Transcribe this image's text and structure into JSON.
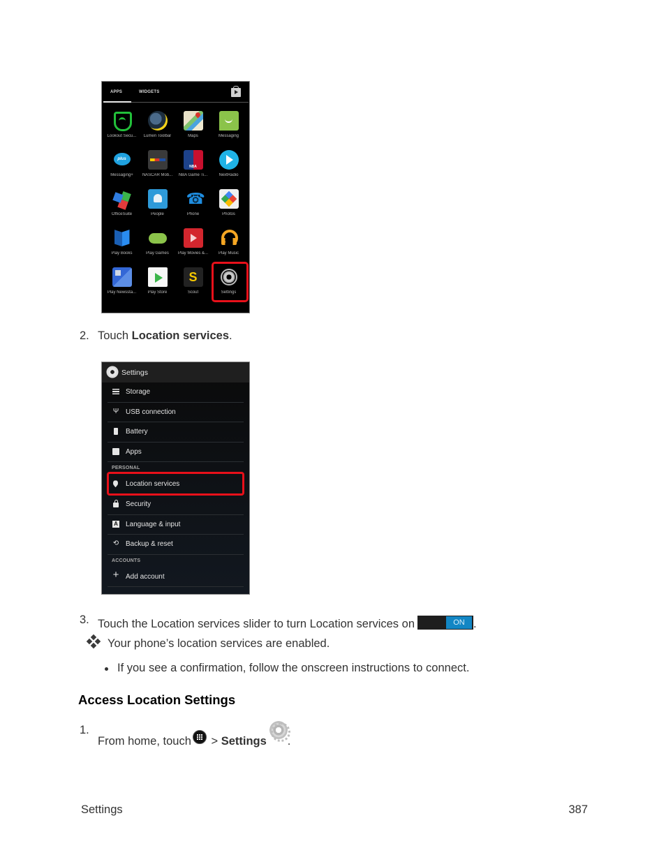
{
  "app_drawer": {
    "tabs": [
      "APPS",
      "WIDGETS"
    ],
    "store_icon": "play-store-bag-icon",
    "apps": [
      {
        "label": "Lookout Secu...",
        "icon": "lookout-icon"
      },
      {
        "label": "Lumen Toolbar",
        "icon": "lumen-icon"
      },
      {
        "label": "Maps",
        "icon": "maps-icon"
      },
      {
        "label": "Messaging",
        "icon": "messaging-icon"
      },
      {
        "label": "Messaging+",
        "icon": "messaging-plus-icon"
      },
      {
        "label": "NASCAR Mob...",
        "icon": "nascar-icon"
      },
      {
        "label": "NBA Game Ti...",
        "icon": "nba-icon"
      },
      {
        "label": "NextRadio",
        "icon": "nextradio-icon"
      },
      {
        "label": "OfficeSuite",
        "icon": "officesuite-icon"
      },
      {
        "label": "People",
        "icon": "people-icon"
      },
      {
        "label": "Phone",
        "icon": "phone-icon"
      },
      {
        "label": "Photos",
        "icon": "photos-icon"
      },
      {
        "label": "Play Books",
        "icon": "play-books-icon"
      },
      {
        "label": "Play Games",
        "icon": "play-games-icon"
      },
      {
        "label": "Play Movies &...",
        "icon": "play-movies-icon"
      },
      {
        "label": "Play Music",
        "icon": "play-music-icon"
      },
      {
        "label": "Play Newssta...",
        "icon": "play-newsstand-icon"
      },
      {
        "label": "Play Store",
        "icon": "play-store-icon"
      },
      {
        "label": "Scout",
        "icon": "scout-icon"
      },
      {
        "label": "Settings",
        "icon": "settings-gear-icon",
        "highlighted": true
      }
    ],
    "highlight_color": "#e8101a"
  },
  "step2": {
    "number": "2.",
    "prefix": "Touch ",
    "bold": "Location services",
    "suffix": "."
  },
  "settings_screen": {
    "title": "Settings",
    "rows": [
      {
        "type": "item",
        "label": "Storage",
        "icon": "storage-icon"
      },
      {
        "type": "item",
        "label": "USB connection",
        "icon": "usb-icon"
      },
      {
        "type": "item",
        "label": "Battery",
        "icon": "battery-icon"
      },
      {
        "type": "item",
        "label": "Apps",
        "icon": "apps-icon"
      },
      {
        "type": "section",
        "label": "PERSONAL"
      },
      {
        "type": "item",
        "label": "Location services",
        "icon": "location-pin-icon",
        "highlighted": true
      },
      {
        "type": "item",
        "label": "Security",
        "icon": "lock-icon"
      },
      {
        "type": "item",
        "label": "Language & input",
        "icon": "language-icon"
      },
      {
        "type": "item",
        "label": "Backup & reset",
        "icon": "backup-icon"
      },
      {
        "type": "section",
        "label": "ACCOUNTS"
      },
      {
        "type": "item",
        "label": "Add account",
        "icon": "plus-icon"
      }
    ]
  },
  "step3": {
    "number": "3.",
    "text": "Touch the Location services slider to turn Location services on",
    "toggle_label": "ON",
    "toggle_color": "#1286c4",
    "suffix": ".",
    "result": "Your phone’s location services are enabled.",
    "bullet": "If you see a confirmation, follow the onscreen instructions to connect."
  },
  "section_heading": "Access Location Settings",
  "step1": {
    "number": "1.",
    "prefix": "From home, touch",
    "separator": " > ",
    "bold": "Settings",
    "suffix": "."
  },
  "footer": {
    "section": "Settings",
    "page": "387"
  }
}
